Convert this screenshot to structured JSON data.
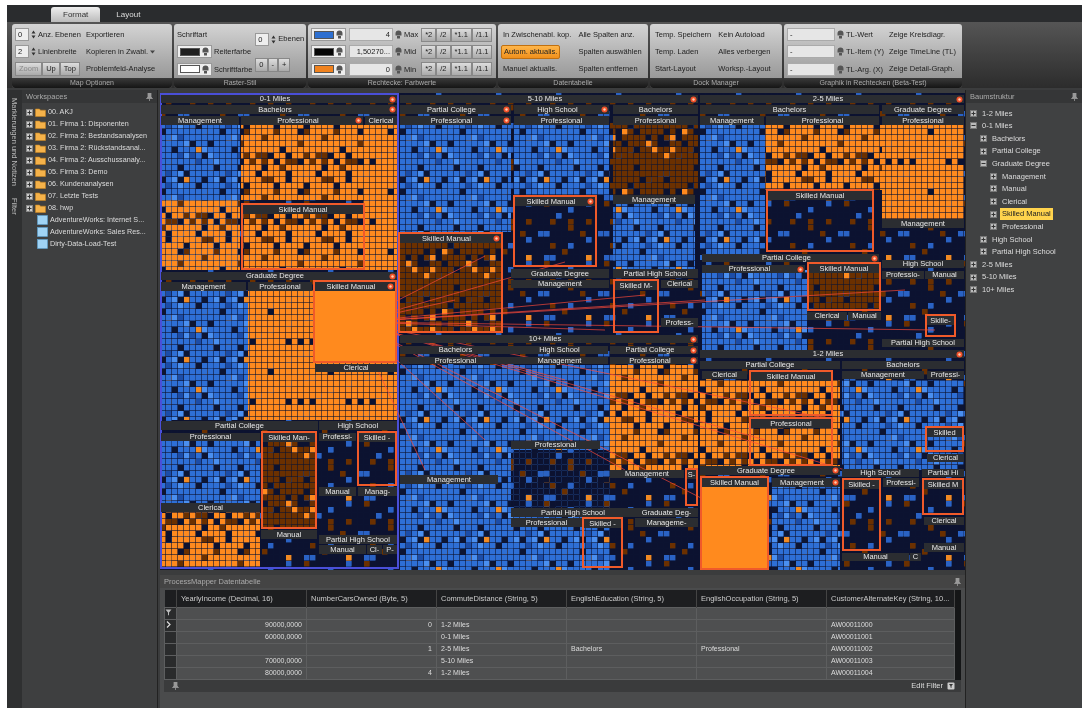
{
  "ribbon": {
    "tabs": [
      {
        "label": "Format",
        "selected": true
      },
      {
        "label": "Layout",
        "selected": false
      }
    ],
    "groups": [
      {
        "title": "Map Optionen",
        "columns": [
          [
            {
              "kind": "spinner",
              "value": "0",
              "label": "Anz. Ebenen"
            },
            {
              "kind": "spinner",
              "value": "2",
              "label": "Linienbreite"
            },
            {
              "kind": "buttons",
              "items": [
                {
                  "label": "Zoom",
                  "disabled": true
                },
                {
                  "label": "Up",
                  "disabled": false
                },
                {
                  "label": "Top",
                  "disabled": false
                }
              ]
            }
          ],
          [
            {
              "kind": "button",
              "label": "Exportieren"
            },
            {
              "kind": "menubutton",
              "label": "Kopieren in Zwabl."
            },
            {
              "kind": "button",
              "label": "Problemfeld-Analyse"
            }
          ]
        ]
      },
      {
        "title": "Raster-Stil",
        "columns": [
          [
            {
              "kind": "text",
              "label": "Schriftart"
            },
            {
              "kind": "color",
              "color": "#1e1e1e",
              "label": "Reiterfarbe"
            },
            {
              "kind": "color",
              "color": "#ffffff",
              "label": "Schriftfarbe"
            }
          ],
          [
            {
              "kind": "spinner",
              "value": "0",
              "label": "Ebenen"
            },
            {
              "kind": "buttons",
              "items": [
                {
                  "label": "0"
                },
                {
                  "label": "-"
                },
                {
                  "label": "+"
                }
              ]
            }
          ]
        ]
      },
      {
        "title": "Rechtecke: Farbwerte",
        "columns": [
          [
            {
              "kind": "color",
              "color": "#2d6fd0"
            },
            {
              "kind": "color",
              "color": "#050505"
            },
            {
              "kind": "color",
              "color": "#f0821e"
            }
          ],
          [
            {
              "kind": "numfield",
              "value": "4",
              "label": "Max"
            },
            {
              "kind": "numfield",
              "value": "1,50270...",
              "label": "Mid"
            },
            {
              "kind": "numfield",
              "value": "0",
              "label": "Min"
            }
          ],
          [
            {
              "kind": "buttons",
              "items": [
                {
                  "label": "*2"
                },
                {
                  "label": "/2"
                },
                {
                  "label": "*1.1"
                },
                {
                  "label": "/1.1"
                }
              ]
            },
            {
              "kind": "buttons",
              "items": [
                {
                  "label": "*2"
                },
                {
                  "label": "/2"
                },
                {
                  "label": "*1.1"
                },
                {
                  "label": "/1.1"
                }
              ]
            },
            {
              "kind": "buttons",
              "items": [
                {
                  "label": "*2"
                },
                {
                  "label": "/2"
                },
                {
                  "label": "*1.1"
                },
                {
                  "label": "/1.1"
                }
              ]
            }
          ]
        ]
      },
      {
        "title": "Datentabelle",
        "columns": [
          [
            {
              "kind": "button",
              "label": "In Zwischenabl. kop.",
              "active": false
            },
            {
              "kind": "button",
              "label": "Autom. aktualis.",
              "active": true
            },
            {
              "kind": "button",
              "label": "Manuel aktualis.",
              "active": false
            }
          ],
          [
            {
              "kind": "button",
              "label": "Alle Spalten anz."
            },
            {
              "kind": "button",
              "label": "Spalten auswählen"
            },
            {
              "kind": "button",
              "label": "Spalten entfernen"
            }
          ]
        ]
      },
      {
        "title": "Dock Manager",
        "columns": [
          [
            {
              "kind": "button",
              "label": "Temp. Speichern"
            },
            {
              "kind": "button",
              "label": "Temp. Laden"
            },
            {
              "kind": "button",
              "label": "Start-Layout"
            }
          ],
          [
            {
              "kind": "button",
              "label": "Kein Autoload"
            },
            {
              "kind": "button",
              "label": "Alles verbergen"
            },
            {
              "kind": "button",
              "label": "Worksp.-Layout"
            }
          ]
        ]
      },
      {
        "title": "Graphik in Rechtecken (Beta-Test)",
        "columns": [
          [
            {
              "kind": "dropdown",
              "value": "-",
              "label": "TL-Wert"
            },
            {
              "kind": "dropdown",
              "value": "-",
              "label": "TL-Item (Y)"
            },
            {
              "kind": "dropdown",
              "value": "-",
              "label": "TL-Arg. (X)"
            }
          ],
          [
            {
              "kind": "button",
              "label": "Zeige Kreisdiagr."
            },
            {
              "kind": "button",
              "label": "Zeige TimeLine (TL)"
            },
            {
              "kind": "button",
              "label": "Zeige Detail-Graph."
            }
          ]
        ]
      }
    ]
  },
  "side_tabs": [
    "Markierungen und Notizen",
    "Filter"
  ],
  "workspaces": {
    "title": "Workspaces",
    "items": [
      {
        "kind": "folder",
        "label": "00. AKJ"
      },
      {
        "kind": "folder",
        "label": "01. Firma 1: Disponenten"
      },
      {
        "kind": "folder",
        "label": "02. Firma 2: Bestandsanalysen"
      },
      {
        "kind": "folder",
        "label": "03. Firma 2: Rückstandsanal..."
      },
      {
        "kind": "folder",
        "label": "04. Firma 2: Ausschussanaly..."
      },
      {
        "kind": "folder",
        "label": "05. Firma 3: Demo"
      },
      {
        "kind": "folder",
        "label": "06. Kundenanalysen"
      },
      {
        "kind": "folder",
        "label": "07. Letzte Tests"
      },
      {
        "kind": "folder",
        "label": "08. hwp"
      },
      {
        "kind": "cube",
        "label": "AdventureWorks: Internet S..."
      },
      {
        "kind": "cube",
        "label": "AdventureWorks: Sales Res..."
      },
      {
        "kind": "cube",
        "label": "Dirty-Data-Load-Test"
      }
    ]
  },
  "treemap": {
    "cells": [
      {
        "kind": "bar",
        "label": "0-1 Miles"
      },
      {
        "kind": "bar",
        "label": "Bachelors"
      },
      {
        "kind": "bar",
        "label": "Management"
      },
      {
        "kind": "bar",
        "label": "Professional"
      },
      {
        "kind": "bar",
        "label": "Clerical"
      },
      {
        "kind": "bar",
        "label": "5-10 Miles"
      },
      {
        "kind": "bar",
        "label": "Partial College"
      },
      {
        "kind": "bar",
        "label": "Professional"
      },
      {
        "kind": "bar",
        "label": "High School"
      },
      {
        "kind": "bar",
        "label": "Professional"
      },
      {
        "kind": "bar",
        "label": "Bachelors"
      },
      {
        "kind": "bar",
        "label": "Professional"
      },
      {
        "kind": "bar",
        "label": "2-5 Miles"
      },
      {
        "kind": "bar",
        "label": "Bachelors"
      },
      {
        "kind": "bar",
        "label": "Graduate Degree"
      },
      {
        "kind": "bar",
        "label": "Management"
      },
      {
        "kind": "bar",
        "label": "Professional"
      },
      {
        "kind": "bar",
        "label": "Professional"
      },
      {
        "kind": "frame",
        "label": "Skilled Manual"
      },
      {
        "kind": "frame",
        "label": "Skilled Manual"
      },
      {
        "kind": "bar",
        "label": "Management"
      },
      {
        "kind": "frame",
        "label": "Skilled Manual"
      },
      {
        "kind": "frame",
        "label": "Skilled Manual"
      },
      {
        "kind": "bar",
        "label": "Management"
      },
      {
        "kind": "bar",
        "label": "Partial College"
      },
      {
        "kind": "bar",
        "label": "Professional"
      },
      {
        "kind": "frame",
        "label": "Skilled Manual"
      },
      {
        "kind": "bar",
        "label": "High School"
      },
      {
        "kind": "bar",
        "label": "Professio-"
      },
      {
        "kind": "bar",
        "label": "Manual"
      },
      {
        "kind": "bar",
        "label": "Clerical"
      },
      {
        "kind": "bar",
        "label": "Manual"
      },
      {
        "kind": "frame",
        "label": "Skille-"
      },
      {
        "kind": "bar",
        "label": "Partial High School"
      },
      {
        "kind": "bar",
        "label": "Graduate Degree"
      },
      {
        "kind": "bar",
        "label": "Management"
      },
      {
        "kind": "bar",
        "label": "Professional"
      },
      {
        "kind": "filled-frame",
        "label": "Skilled Manual"
      },
      {
        "kind": "bar",
        "label": "Clerical"
      },
      {
        "kind": "bar",
        "label": "Graduate Degree"
      },
      {
        "kind": "bar",
        "label": "Management"
      },
      {
        "kind": "bar",
        "label": "Partial High School"
      },
      {
        "kind": "frame",
        "label": "Skilled M-"
      },
      {
        "kind": "bar",
        "label": "Clerical"
      },
      {
        "kind": "bar",
        "label": "Profess-"
      },
      {
        "kind": "bar",
        "label": "10+ Miles"
      },
      {
        "kind": "bar",
        "label": "Bachelors"
      },
      {
        "kind": "bar",
        "label": "Professional"
      },
      {
        "kind": "bar",
        "label": "High School"
      },
      {
        "kind": "bar",
        "label": "Management"
      },
      {
        "kind": "bar",
        "label": "Partial College"
      },
      {
        "kind": "bar",
        "label": "Professional"
      },
      {
        "kind": "bar",
        "label": "1-2 Miles"
      },
      {
        "kind": "bar",
        "label": "Partial College"
      },
      {
        "kind": "bar",
        "label": "Bachelors"
      },
      {
        "kind": "bar",
        "label": "Clerical"
      },
      {
        "kind": "frame",
        "label": "Skilled Manual"
      },
      {
        "kind": "bar",
        "label": "Management"
      },
      {
        "kind": "bar",
        "label": "Professi-"
      },
      {
        "kind": "frame",
        "label": "Professional"
      },
      {
        "kind": "frame",
        "label": "Skilled"
      },
      {
        "kind": "bar",
        "label": "Clerical"
      },
      {
        "kind": "bar",
        "label": "Professional"
      },
      {
        "kind": "bar",
        "label": "Management"
      },
      {
        "kind": "bar",
        "label": "Management"
      },
      {
        "kind": "frame",
        "label": "S-"
      },
      {
        "kind": "bar",
        "label": "Graduate Degree"
      },
      {
        "kind": "filled-frame",
        "label": "Skilled Manual"
      },
      {
        "kind": "bar",
        "label": "Management"
      },
      {
        "kind": "bar",
        "label": "High School"
      },
      {
        "kind": "frame",
        "label": "Skilled -"
      },
      {
        "kind": "bar",
        "label": "Professi-"
      },
      {
        "kind": "bar",
        "label": "Partial Hi"
      },
      {
        "kind": "frame",
        "label": "Skilled M"
      },
      {
        "kind": "bar",
        "label": "Clerical"
      },
      {
        "kind": "bar",
        "label": "Manual"
      },
      {
        "kind": "bar",
        "label": "Manual"
      },
      {
        "kind": "bar",
        "label": "C"
      },
      {
        "kind": "bar",
        "label": "Partial High School"
      },
      {
        "kind": "bar",
        "label": "Professional"
      },
      {
        "kind": "frame",
        "label": "Skilled -"
      },
      {
        "kind": "bar",
        "label": "Graduate Deg-"
      },
      {
        "kind": "bar",
        "label": "Manageme-"
      },
      {
        "kind": "bar",
        "label": "Partial College"
      },
      {
        "kind": "bar",
        "label": "High School"
      },
      {
        "kind": "bar",
        "label": "Professional"
      },
      {
        "kind": "frame",
        "label": "Skilled Man-"
      },
      {
        "kind": "bar",
        "label": "Professi-"
      },
      {
        "kind": "frame",
        "label": "Skilled -"
      },
      {
        "kind": "bar",
        "label": "Manual"
      },
      {
        "kind": "bar",
        "label": "Manag-"
      },
      {
        "kind": "bar",
        "label": "Clerical"
      },
      {
        "kind": "bar",
        "label": "Manual"
      },
      {
        "kind": "bar",
        "label": "Partial High School"
      },
      {
        "kind": "bar",
        "label": "Manual"
      },
      {
        "kind": "bar",
        "label": "Cl-"
      },
      {
        "kind": "bar",
        "label": "P-"
      }
    ]
  },
  "tree": {
    "title": "Baumstruktur",
    "items": [
      {
        "label": "1-2 Miles",
        "expanded": false,
        "selected": false
      },
      {
        "label": "0-1 Miles",
        "expanded": true,
        "selected": false,
        "children": [
          {
            "label": "Bachelors",
            "expanded": false,
            "selected": false
          },
          {
            "label": "Partial College",
            "expanded": false,
            "selected": false
          },
          {
            "label": "Graduate Degree",
            "expanded": true,
            "selected": false,
            "children": [
              {
                "label": "Management",
                "expanded": false,
                "selected": false
              },
              {
                "label": "Manual",
                "expanded": false,
                "selected": false
              },
              {
                "label": "Clerical",
                "expanded": false,
                "selected": false
              },
              {
                "label": "Skilled Manual",
                "expanded": false,
                "selected": true
              },
              {
                "label": "Professional",
                "expanded": false,
                "selected": false
              }
            ]
          },
          {
            "label": "High School",
            "expanded": false,
            "selected": false
          },
          {
            "label": "Partial High School",
            "expanded": false,
            "selected": false
          }
        ]
      },
      {
        "label": "2-5 Miles",
        "expanded": false,
        "selected": false
      },
      {
        "label": "5-10 Miles",
        "expanded": false,
        "selected": false
      },
      {
        "label": "10+ Miles",
        "expanded": false,
        "selected": false
      }
    ]
  },
  "datatable": {
    "title": "ProcessMapper Datentabelle",
    "columns": [
      "YearlyIncome (Decimal, 16)",
      "NumberCarsOwned (Byte, 5)",
      "CommuteDistance (String, 5)",
      "EnglishEducation (String, 5)",
      "EnglishOccupation (String, 5)",
      "CustomerAlternateKey (String, 10..."
    ],
    "rows": [
      {
        "current": true,
        "income": "90000,0000",
        "cars": "0",
        "commute": "1-2 Miles",
        "key": "AW00011000"
      },
      {
        "current": false,
        "income": "60000,0000",
        "commute": "0-1 Miles",
        "key": "AW00011001"
      },
      {
        "current": false,
        "cars": "1",
        "commute": "2-5 Miles",
        "education": "Bachelors",
        "occupation": "Professional",
        "key": "AW00011002"
      },
      {
        "current": false,
        "income": "70000,0000",
        "commute": "5-10 Miles",
        "key": "AW00011003"
      },
      {
        "current": false,
        "income": "80000,0000",
        "cars": "4",
        "commute": "1-2 Miles",
        "key": "AW00011004"
      }
    ],
    "footer_action": "Edit Filter"
  }
}
